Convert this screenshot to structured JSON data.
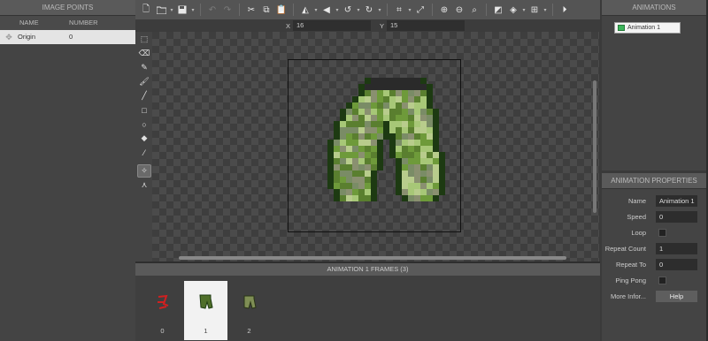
{
  "image_points": {
    "title": "IMAGE POINTS",
    "columns": [
      "NAME",
      "NUMBER"
    ],
    "rows": [
      {
        "name": "Origin",
        "number": "0"
      }
    ]
  },
  "toolbar": {
    "icons": [
      "new-file-icon",
      "open-folder-icon",
      "save-icon",
      "undo-icon",
      "redo-icon",
      "cut-icon",
      "copy-icon",
      "paste-icon",
      "flip-horizontal-icon",
      "flip-vertical-icon",
      "rotate-left-icon",
      "rotate-right-icon",
      "crop-icon",
      "resize-icon",
      "zoom-in-icon",
      "zoom-out-icon",
      "zoom-fit-icon",
      "grid-color-icon",
      "layers-icon",
      "grid-icon",
      "play-icon"
    ]
  },
  "coords": {
    "x_label": "X",
    "x_value": "16",
    "y_label": "Y",
    "y_value": "15"
  },
  "tools": [
    "select-icon",
    "eraser-icon",
    "pencil-icon",
    "brush-icon",
    "line-icon",
    "rectangle-icon",
    "ellipse-icon",
    "fill-icon",
    "eyedropper-icon",
    "origin-point-icon",
    "action-points-icon"
  ],
  "frames": {
    "title": "ANIMATION 1 FRAMES (3)",
    "items": [
      {
        "number": "0"
      },
      {
        "number": "1"
      },
      {
        "number": "2"
      }
    ],
    "selected": 1
  },
  "animations": {
    "title": "ANIMATIONS",
    "items": [
      {
        "name": "Animation 1"
      }
    ]
  },
  "properties": {
    "title": "ANIMATION PROPERTIES",
    "name_label": "Name",
    "name_value": "Animation 1",
    "speed_label": "Speed",
    "speed_value": "0",
    "loop_label": "Loop",
    "repeat_count_label": "Repeat Count",
    "repeat_count_value": "1",
    "repeat_to_label": "Repeat To",
    "repeat_to_value": "0",
    "ping_pong_label": "Ping Pong",
    "more_info_label": "More Infor...",
    "help_label": "Help"
  },
  "colors": {
    "accent_green": "#3cb45a",
    "pants_dark": "#1d3a12",
    "pants_mid": "#6e9a3a",
    "pants_light": "#a7c777"
  }
}
